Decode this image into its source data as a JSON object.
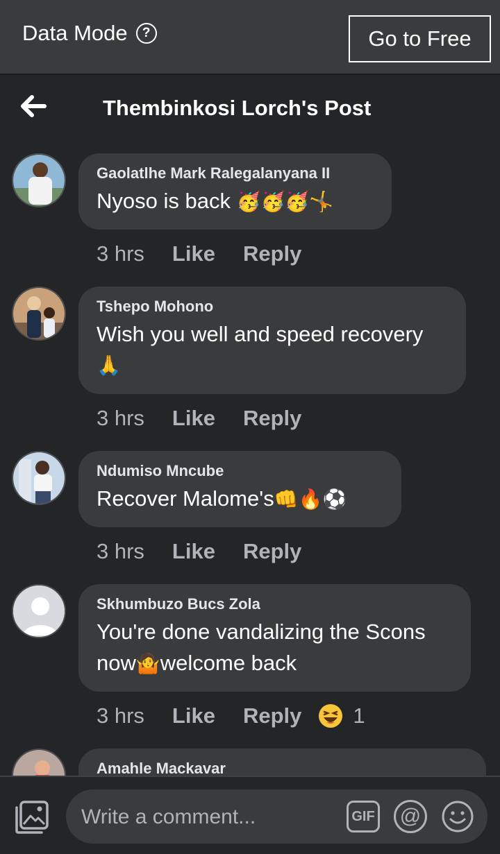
{
  "topbar": {
    "data_mode_label": "Data Mode",
    "help_symbol": "?",
    "go_free_label": "Go to Free"
  },
  "header": {
    "title": "Thembinkosi Lorch's Post"
  },
  "comments": [
    {
      "author": "Gaolatlhe Mark Ralegalanyana II",
      "text": "Nyoso is back",
      "emojis": "🥳🥳🥳🤸",
      "time": "3 hrs",
      "like": "Like",
      "reply": "Reply"
    },
    {
      "author": "Tshepo Mohono",
      "text": "Wish you well and speed recovery",
      "emojis": "🙏",
      "time": "3 hrs",
      "like": "Like",
      "reply": "Reply"
    },
    {
      "author": "Ndumiso Mncube",
      "text": "Recover Malome's",
      "emojis": "👊🔥⚽",
      "time": "3 hrs",
      "like": "Like",
      "reply": "Reply"
    },
    {
      "author": "Skhumbuzo Bucs Zola",
      "text_line1": "You're done vandalizing the Scons",
      "text_line2_pre": "now",
      "emoji_mid": "🤷",
      "text_line2_post": "welcome back",
      "time": "3 hrs",
      "like": "Like",
      "reply": "Reply",
      "reaction_icon": "laughing-face-icon",
      "reaction_count": "1"
    },
    {
      "author": "Amahle Mackavar"
    }
  ],
  "composer": {
    "placeholder": "Write a comment...",
    "gif_label": "GIF",
    "at_symbol": "@"
  },
  "colors": {
    "background": "#242526",
    "topbar": "#3a3b3c",
    "bubble": "#3a3b3c",
    "meta_text": "#b0b3b8"
  }
}
